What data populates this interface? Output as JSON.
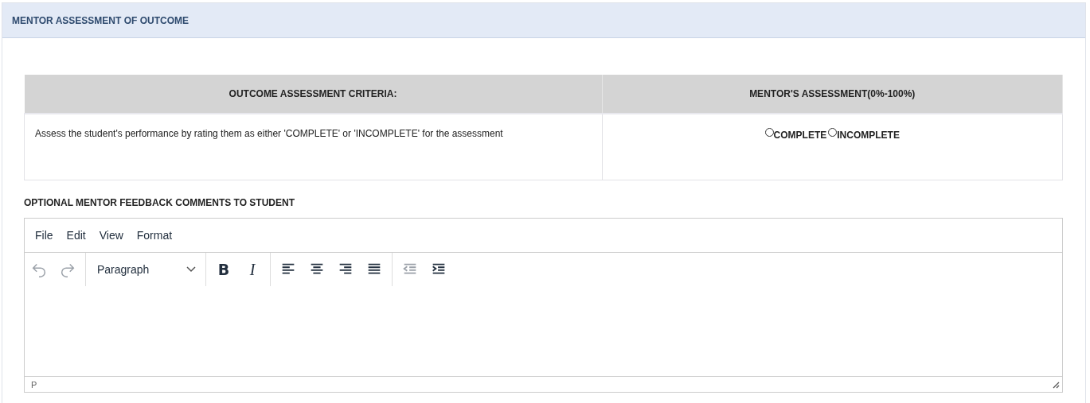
{
  "panel": {
    "title": "MENTOR ASSESSMENT OF OUTCOME"
  },
  "table": {
    "columns": [
      "OUTCOME ASSESSMENT CRITERIA:",
      "MENTOR'S ASSESSMENT(0%-100%)"
    ],
    "rows": [
      {
        "criteria": "Assess the student's performance by rating them as either 'COMPLETE' or 'INCOMPLETE' for the assessment",
        "options": [
          {
            "label": "COMPLETE",
            "selected": false
          },
          {
            "label": "INCOMPLETE",
            "selected": false
          }
        ]
      }
    ]
  },
  "feedback": {
    "label": "OPTIONAL MENTOR FEEDBACK COMMENTS TO STUDENT",
    "menu": [
      "File",
      "Edit",
      "View",
      "Format"
    ],
    "toolbar": [
      {
        "kind": "undo",
        "disabled": true
      },
      {
        "kind": "redo",
        "disabled": true
      },
      {
        "kind": "sep"
      },
      {
        "kind": "block",
        "value": "Paragraph"
      },
      {
        "kind": "sep"
      },
      {
        "kind": "bold",
        "glyph": "B",
        "disabled": false
      },
      {
        "kind": "italic",
        "glyph": "I",
        "disabled": false
      },
      {
        "kind": "sep"
      },
      {
        "kind": "align-left",
        "disabled": false
      },
      {
        "kind": "align-center",
        "disabled": false
      },
      {
        "kind": "align-right",
        "disabled": false
      },
      {
        "kind": "justify",
        "disabled": false
      },
      {
        "kind": "sep"
      },
      {
        "kind": "outdent",
        "disabled": true
      },
      {
        "kind": "indent",
        "disabled": false
      }
    ],
    "status_path": "P"
  }
}
